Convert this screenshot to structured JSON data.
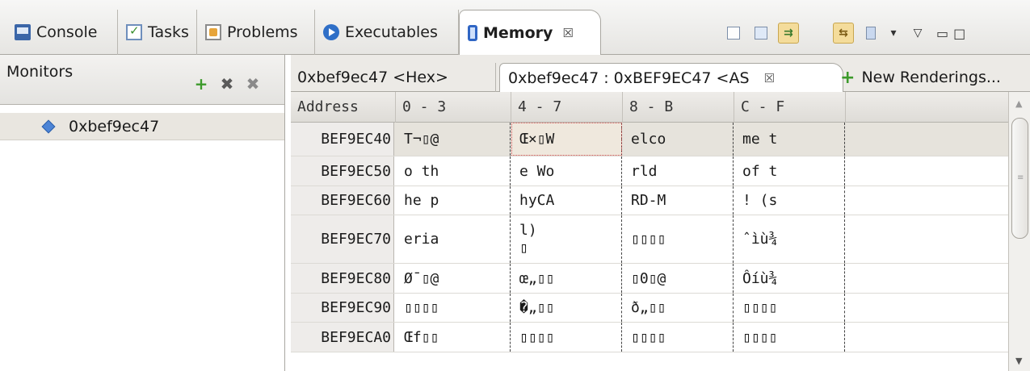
{
  "view_tabs": [
    {
      "label": "Console",
      "icon": "console-icon"
    },
    {
      "label": "Tasks",
      "icon": "tasks-icon"
    },
    {
      "label": "Problems",
      "icon": "problems-icon"
    },
    {
      "label": "Executables",
      "icon": "executables-icon"
    },
    {
      "label": "Memory",
      "icon": "memory-icon",
      "active": true,
      "close": "☒"
    }
  ],
  "toolbar": {
    "view_menu": "▽",
    "minimize": "▭",
    "maximize": "□"
  },
  "monitors": {
    "title": "Monitors",
    "add_icon": "+",
    "remove_icon": "✖",
    "remove_all_icon": "✖",
    "items": [
      {
        "label": "0xbef9ec47"
      }
    ]
  },
  "renderings": {
    "tabs": [
      {
        "label": "0xbef9ec47 <Hex>"
      },
      {
        "label": "0xbef9ec47 : 0xBEF9EC47 <AS",
        "close": "☒",
        "active": true
      }
    ],
    "new_renderings": "New Renderings..."
  },
  "table": {
    "headers": [
      "Address",
      "0 - 3",
      "4 - 7",
      "8 - B",
      "C - F"
    ],
    "rows": [
      [
        "BEF9EC40",
        "T¬▯@",
        "Œ×▯W",
        "elco",
        "me t"
      ],
      [
        "BEF9EC50",
        "o th",
        "e Wo",
        "rld ",
        "of t"
      ],
      [
        "BEF9EC60",
        "he p",
        "hyCA",
        "RD-M",
        "! (s"
      ],
      [
        "BEF9EC70",
        "eria",
        "l)\n▯",
        "▯▯▯▯",
        "ˆìù¾"
      ],
      [
        "BEF9EC80",
        "Ø¯▯@",
        "œ„▯▯",
        "▯0▯@",
        "Ôíù¾"
      ],
      [
        "BEF9EC90",
        "▯▯▯▯",
        "�„▯▯",
        "ð„▯▯",
        "▯▯▯▯"
      ],
      [
        "BEF9ECA0",
        "Œf▯▯",
        "▯▯▯▯",
        "▯▯▯▯",
        "▯▯▯▯"
      ]
    ]
  }
}
